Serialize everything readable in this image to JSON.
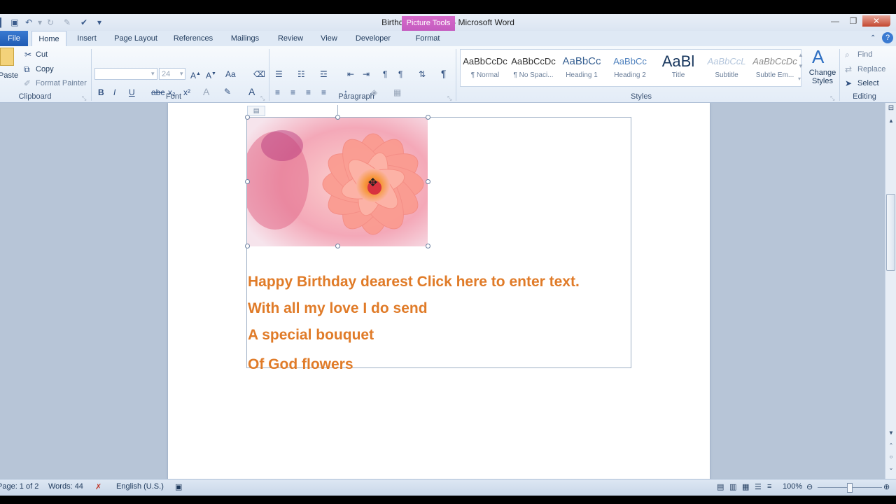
{
  "window": {
    "title": "BirthdayCard.docx - Microsoft Word",
    "contextual_group": "Picture Tools"
  },
  "tabs": [
    "File",
    "Home",
    "Insert",
    "Page Layout",
    "References",
    "Mailings",
    "Review",
    "View",
    "Developer",
    "Format"
  ],
  "active_tab": "Home",
  "ribbon": {
    "clipboard": {
      "label": "Clipboard",
      "paste": "Paste",
      "cut": "Cut",
      "copy": "Copy",
      "format_painter": "Format Painter"
    },
    "font": {
      "label": "Font",
      "font_name": "",
      "font_size": "24"
    },
    "paragraph": {
      "label": "Paragraph"
    },
    "styles": {
      "label": "Styles",
      "gallery": [
        {
          "sample": "AaBbCcDc",
          "name": "¶ Normal"
        },
        {
          "sample": "AaBbCcDc",
          "name": "¶ No Spaci..."
        },
        {
          "sample": "AaBbCc",
          "name": "Heading 1"
        },
        {
          "sample": "AaBbCc",
          "name": "Heading 2"
        },
        {
          "sample": "AaBl",
          "name": "Title"
        },
        {
          "sample": "AaBbCcL",
          "name": "Subtitle"
        },
        {
          "sample": "AaBbCcDc",
          "name": "Subtle Em..."
        }
      ],
      "change_styles": "Change Styles"
    },
    "editing": {
      "label": "Editing",
      "find": "Find",
      "replace": "Replace",
      "select": "Select"
    }
  },
  "document": {
    "lines": [
      "Happy Birthday  dearest  Click here to enter text.",
      "With all my love I do send",
      "A  special bouquet",
      "Of  God flowers"
    ],
    "text_color": "#e07b28"
  },
  "status": {
    "page": "Page: 1 of 2",
    "words": "Words: 44",
    "language": "English (U.S.)",
    "zoom": "100%"
  }
}
